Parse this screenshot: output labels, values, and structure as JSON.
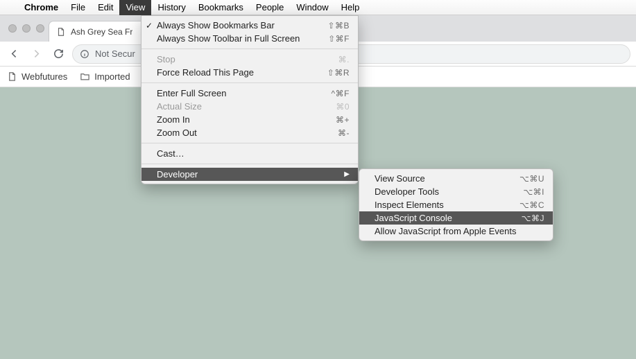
{
  "menubar": {
    "app": "Chrome",
    "items": [
      "File",
      "Edit",
      "View",
      "History",
      "Bookmarks",
      "People",
      "Window",
      "Help"
    ],
    "active": "View"
  },
  "tab": {
    "title": "Ash Grey Sea Fr"
  },
  "toolbar": {
    "security_label": "Not Secur"
  },
  "bookmarks": {
    "items": [
      {
        "label": "Webfutures",
        "icon": "page"
      },
      {
        "label": "Imported",
        "icon": "folder"
      }
    ]
  },
  "view_menu": {
    "groups": [
      [
        {
          "label": "Always Show Bookmarks Bar",
          "shortcut": "⇧⌘B",
          "checked": true
        },
        {
          "label": "Always Show Toolbar in Full Screen",
          "shortcut": "⇧⌘F"
        }
      ],
      [
        {
          "label": "Stop",
          "shortcut": "⌘.",
          "disabled": true
        },
        {
          "label": "Force Reload This Page",
          "shortcut": "⇧⌘R"
        }
      ],
      [
        {
          "label": "Enter Full Screen",
          "shortcut": "^⌘F"
        },
        {
          "label": "Actual Size",
          "shortcut": "⌘0",
          "disabled": true
        },
        {
          "label": "Zoom In",
          "shortcut": "⌘+"
        },
        {
          "label": "Zoom Out",
          "shortcut": "⌘-"
        }
      ],
      [
        {
          "label": "Cast…"
        }
      ],
      [
        {
          "label": "Developer",
          "submenu": true,
          "highlight": true
        }
      ]
    ]
  },
  "developer_submenu": {
    "items": [
      {
        "label": "View Source",
        "shortcut": "⌥⌘U"
      },
      {
        "label": "Developer Tools",
        "shortcut": "⌥⌘I"
      },
      {
        "label": "Inspect Elements",
        "shortcut": "⌥⌘C"
      },
      {
        "label": "JavaScript Console",
        "shortcut": "⌥⌘J",
        "highlight": true
      },
      {
        "label": "Allow JavaScript from Apple Events"
      }
    ]
  }
}
